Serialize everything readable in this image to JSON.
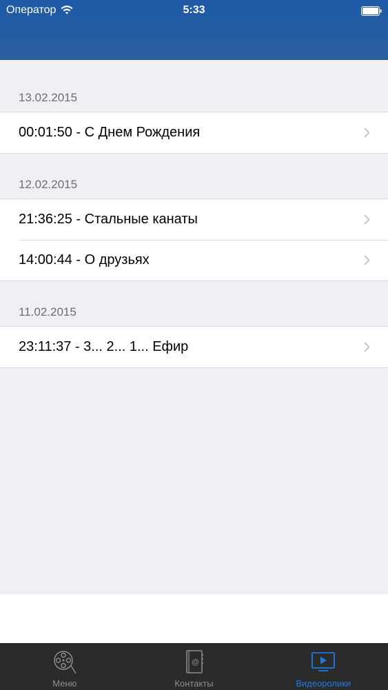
{
  "status_bar": {
    "carrier": "Оператор",
    "time": "5:33"
  },
  "sections": [
    {
      "date": "13.02.2015",
      "items": [
        {
          "label": "00:01:50 - С Днем Рождения"
        }
      ]
    },
    {
      "date": "12.02.2015",
      "items": [
        {
          "label": "21:36:25 - Стальные канаты"
        },
        {
          "label": "14:00:44 - О друзьях"
        }
      ]
    },
    {
      "date": "11.02.2015",
      "items": [
        {
          "label": "23:11:37 - 3... 2... 1... Ефир"
        }
      ]
    }
  ],
  "tab_bar": {
    "tabs": [
      {
        "label": "Меню",
        "icon": "film-reel-icon",
        "active": false
      },
      {
        "label": "Контакты",
        "icon": "contacts-book-icon",
        "active": false
      },
      {
        "label": "Видеоролики",
        "icon": "video-play-icon",
        "active": true
      }
    ]
  },
  "colors": {
    "header": "#2a5f9e",
    "background": "#efeff4",
    "tab_bar": "#2b2b2b",
    "active_tab": "#1f7ae0",
    "inactive_tab": "#8e8e8e"
  }
}
